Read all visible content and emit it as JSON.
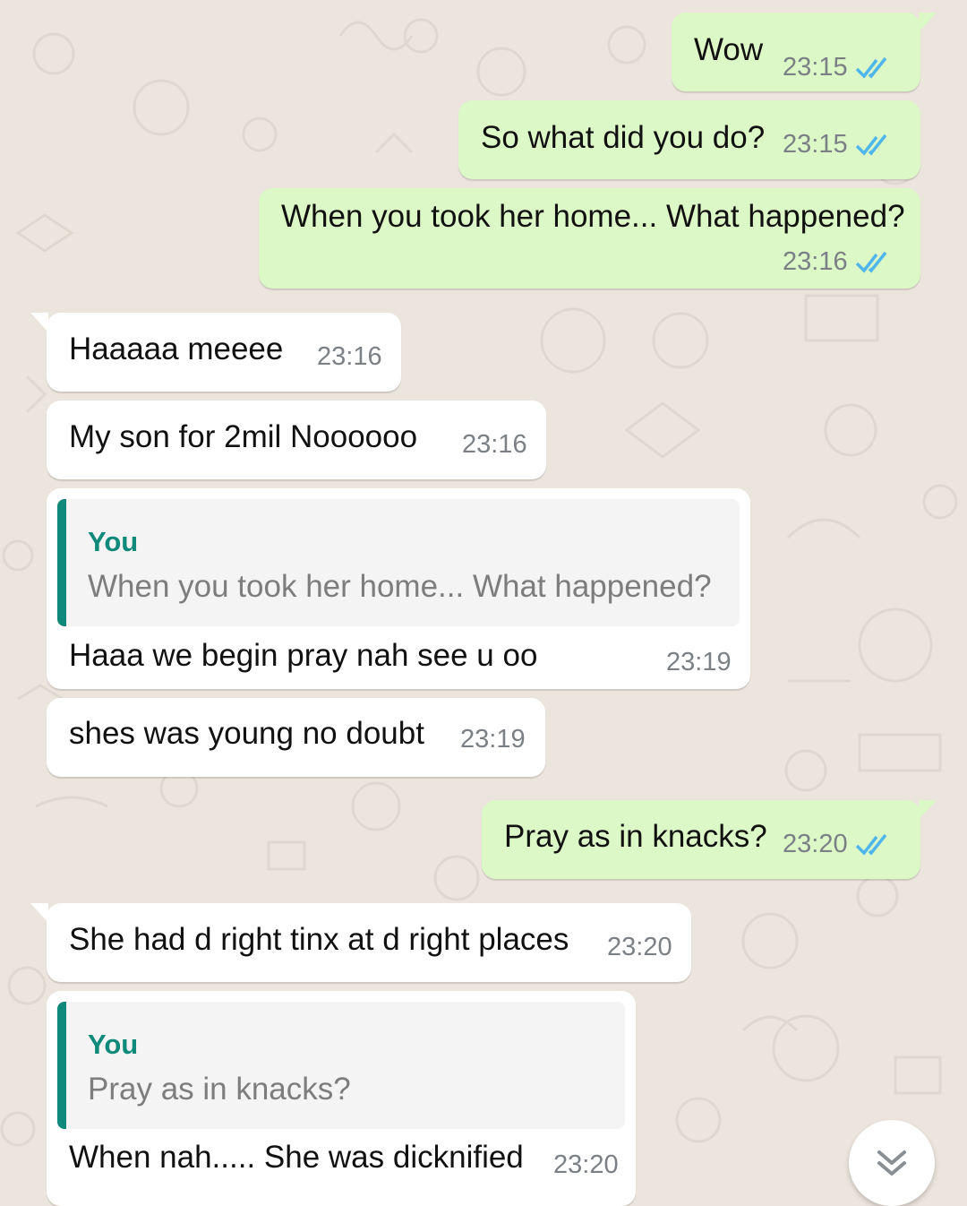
{
  "chat": {
    "messages": [
      {
        "direction": "out",
        "text": "Wow",
        "time": "23:15",
        "status": "read"
      },
      {
        "direction": "out",
        "text": "So what did you do?",
        "time": "23:15",
        "status": "read"
      },
      {
        "direction": "out",
        "text": "When you took her home... What happened?",
        "time": "23:16",
        "status": "read"
      },
      {
        "direction": "in",
        "text": "Haaaaa meeee",
        "time": "23:16"
      },
      {
        "direction": "in",
        "text": "My son for 2mil Noooooo",
        "time": "23:16"
      },
      {
        "direction": "in",
        "text": "Haaa we begin pray nah see u oo",
        "time": "23:19",
        "quoted": {
          "author": "You",
          "text": "When you took her home... What happened?"
        }
      },
      {
        "direction": "in",
        "text": "shes was young no doubt",
        "time": "23:19"
      },
      {
        "direction": "out",
        "text": "Pray as in knacks?",
        "time": "23:20",
        "status": "read"
      },
      {
        "direction": "in",
        "text": "She had d right tinx at d right places",
        "time": "23:20"
      },
      {
        "direction": "in",
        "text": "When nah..... She was dicknified",
        "time": "23:20",
        "quoted": {
          "author": "You",
          "text": "Pray as in knacks?"
        }
      }
    ]
  },
  "scroll_button": {
    "icon": "double-chevron-down-icon"
  },
  "colors": {
    "background": "#ece5dd",
    "outgoing_bubble": "#dcf8c6",
    "incoming_bubble": "#ffffff",
    "read_ticks": "#4fb6ec",
    "quote_accent": "#0f8a7a",
    "timestamp": "#7b8086"
  }
}
